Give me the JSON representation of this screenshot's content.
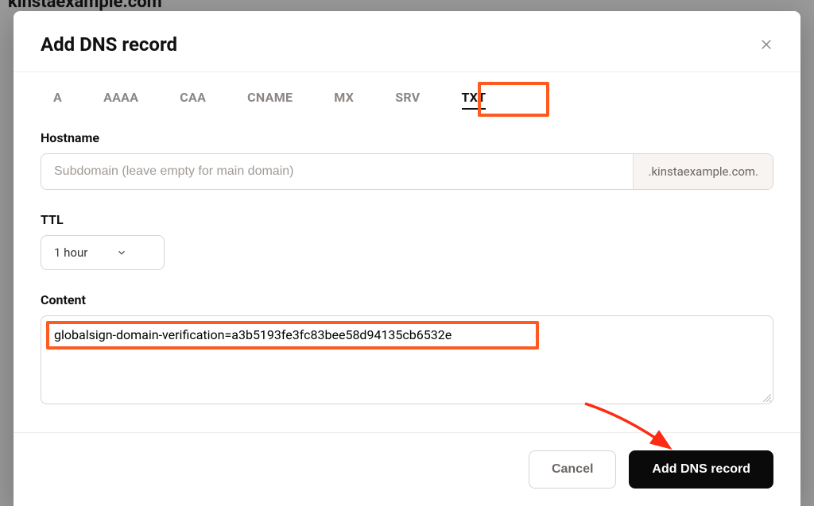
{
  "backdrop_fragment": "kinstaexample.com",
  "modal": {
    "title": "Add DNS record",
    "tabs": [
      "A",
      "AAAA",
      "CAA",
      "CNAME",
      "MX",
      "SRV",
      "TXT"
    ],
    "active_tab": "TXT",
    "hostname": {
      "label": "Hostname",
      "placeholder": "Subdomain (leave empty for main domain)",
      "value": "",
      "suffix": ".kinstaexample.com."
    },
    "ttl": {
      "label": "TTL",
      "value": "1 hour"
    },
    "content": {
      "label": "Content",
      "value": "globalsign-domain-verification=a3b5193fe3fc83bee58d94135cb6532e"
    },
    "footer": {
      "cancel": "Cancel",
      "submit": "Add DNS record"
    }
  },
  "annotations": {
    "highlight_color": "#ff5a1f"
  }
}
